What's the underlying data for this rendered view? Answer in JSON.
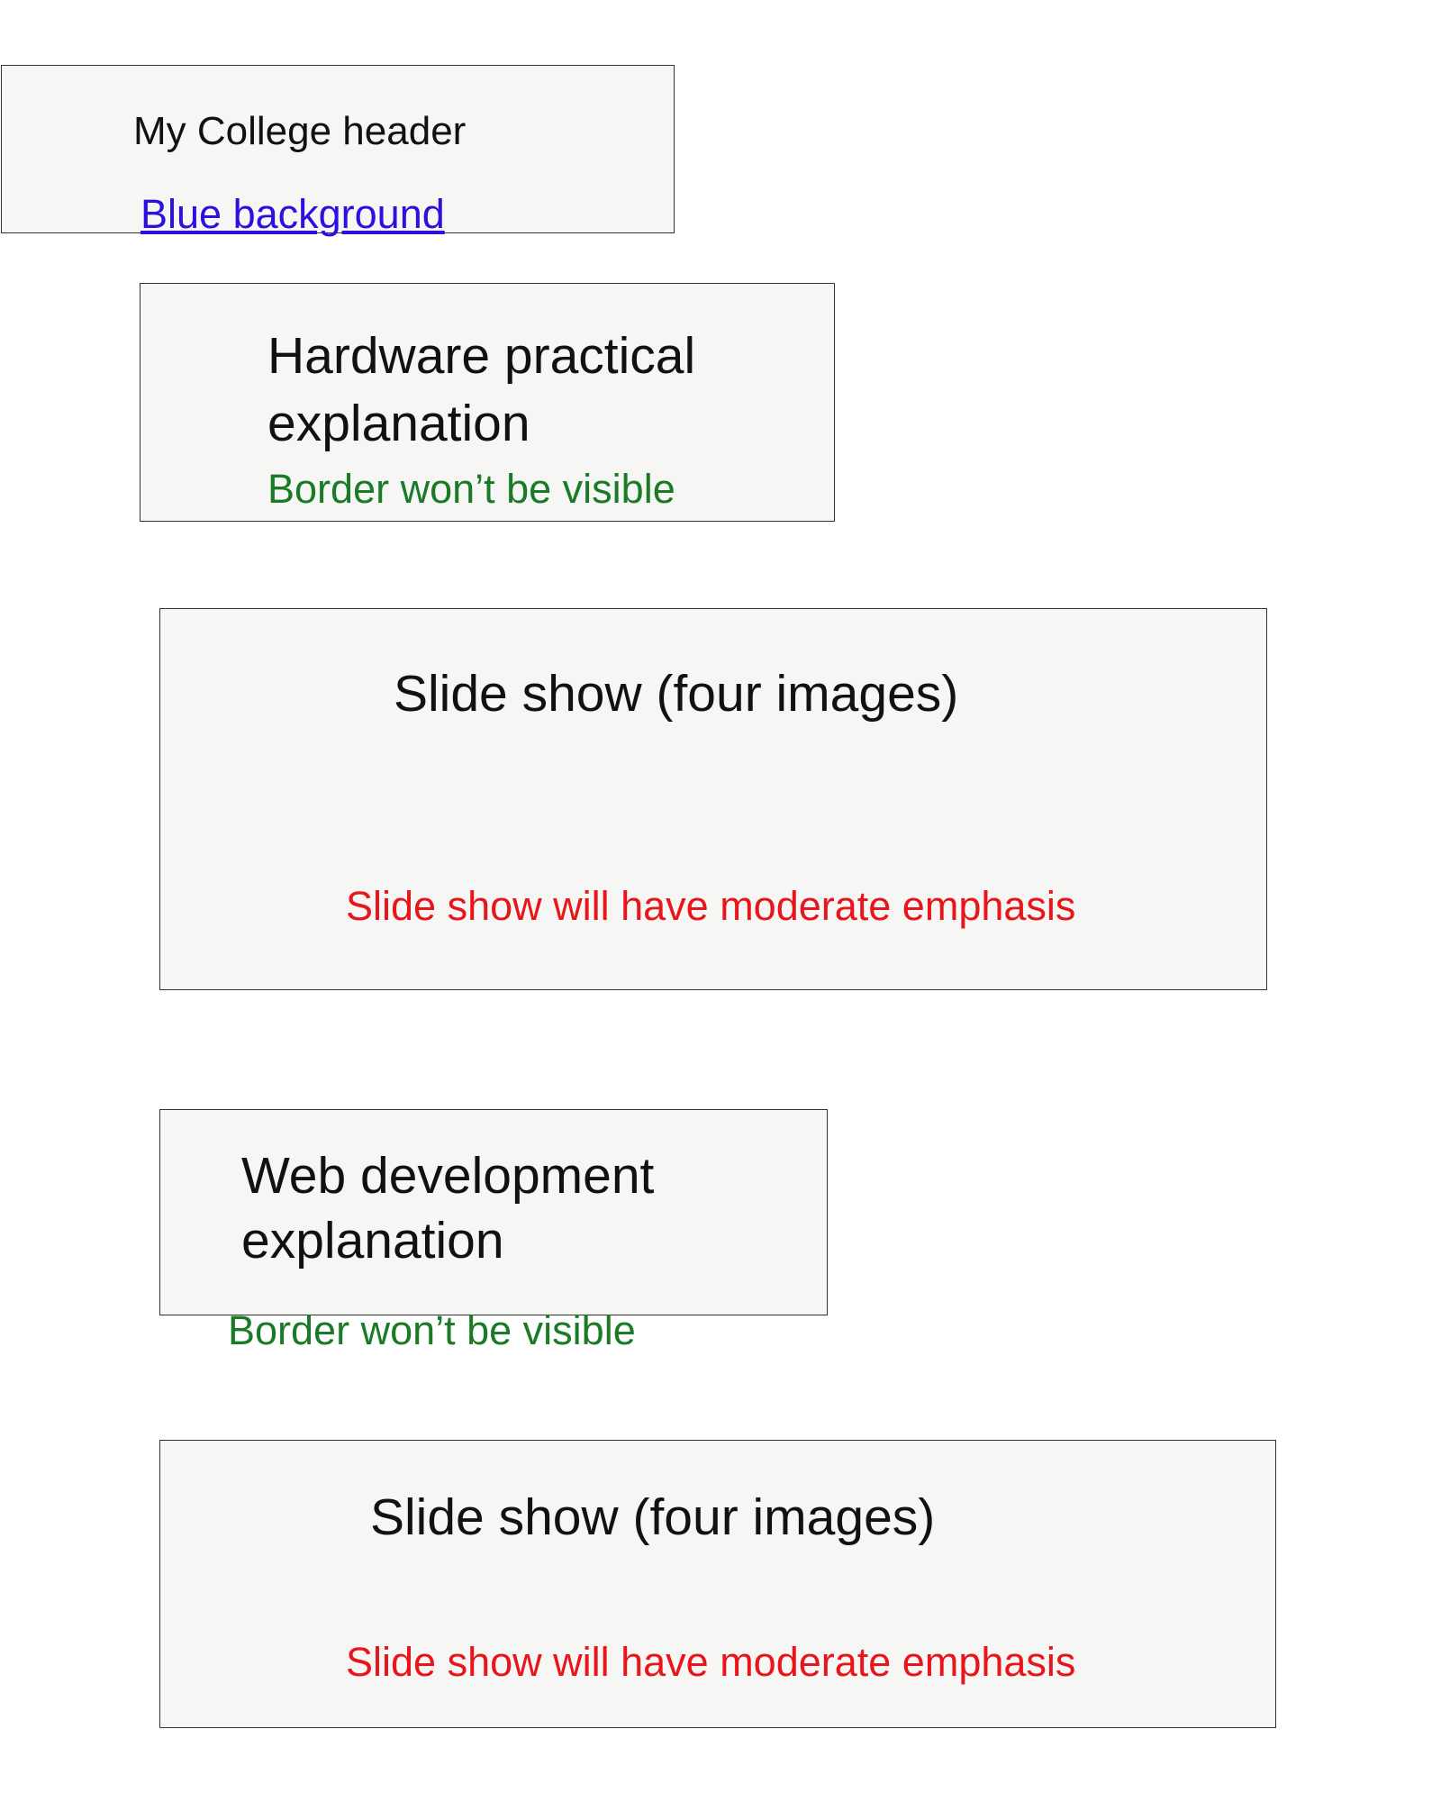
{
  "colors": {
    "box_fill": "#f6f7f5",
    "box_border": "#333333",
    "title_text": "#111111",
    "blue_note": "#2c10e0",
    "green_note": "#1a7a26",
    "red_note": "#e8151b",
    "page_background": "#ffffff"
  },
  "header": {
    "title": "My College header",
    "note": "Blue background"
  },
  "hardware": {
    "title_line1": "Hardware practical",
    "title_line2": "explanation",
    "note": "Border won’t be visible"
  },
  "slideshow_1": {
    "title": "Slide show (four images)",
    "note": "Slide show will have moderate emphasis"
  },
  "webdev": {
    "title_line1": "Web development",
    "title_line2": "explanation",
    "note": "Border won’t be visible"
  },
  "slideshow_2": {
    "title": "Slide show (four images)",
    "note": "Slide show will have moderate emphasis"
  }
}
